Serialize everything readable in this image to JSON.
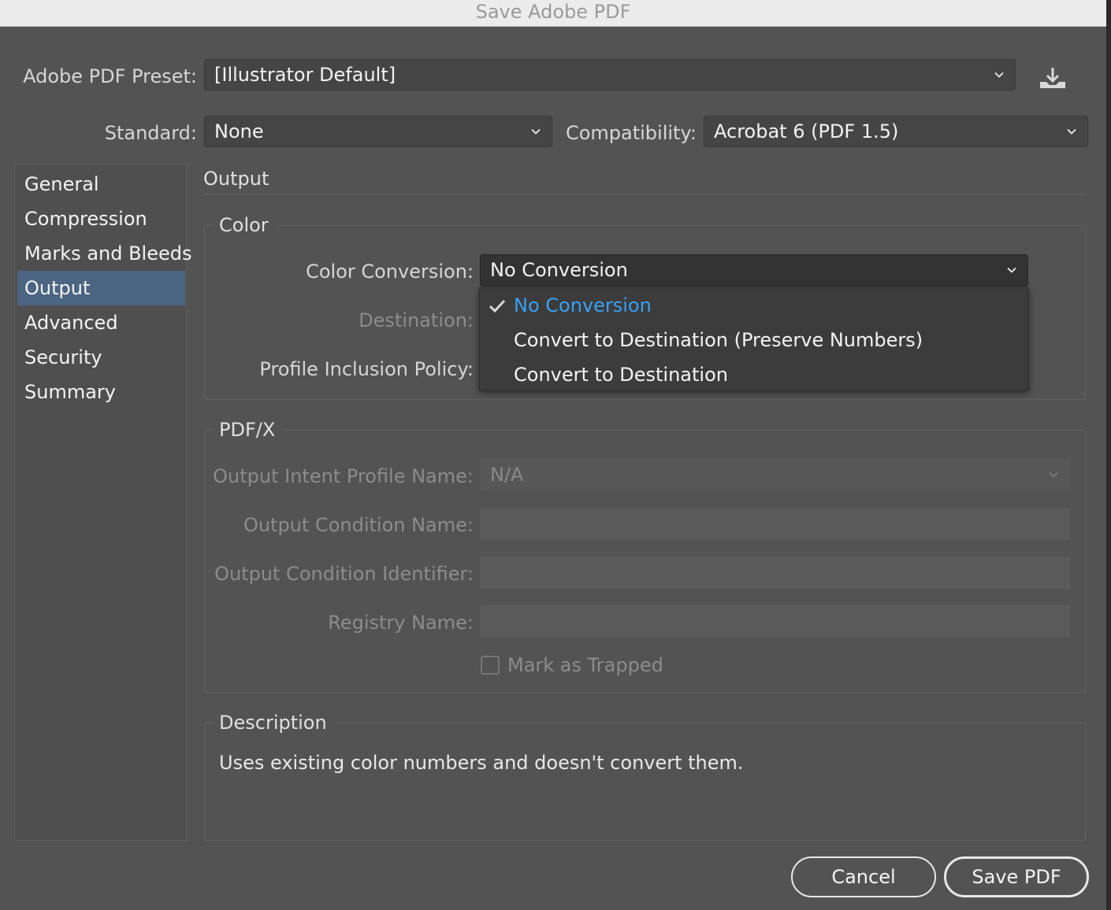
{
  "window": {
    "title": "Save Adobe PDF"
  },
  "preset": {
    "label": "Adobe PDF Preset:",
    "value": "[Illustrator Default]",
    "save_icon": "save-preset-icon"
  },
  "standard": {
    "label": "Standard:",
    "value": "None"
  },
  "compatibility": {
    "label": "Compatibility:",
    "value": "Acrobat 6 (PDF 1.5)"
  },
  "sidebar": {
    "items": [
      {
        "label": "General"
      },
      {
        "label": "Compression"
      },
      {
        "label": "Marks and Bleeds"
      },
      {
        "label": "Output"
      },
      {
        "label": "Advanced"
      },
      {
        "label": "Security"
      },
      {
        "label": "Summary"
      }
    ],
    "selected": "Output"
  },
  "panel": {
    "title": "Output"
  },
  "color": {
    "title": "Color",
    "conversion_label": "Color Conversion:",
    "conversion_value": "No Conversion",
    "destination_label": "Destination:",
    "profile_label": "Profile Inclusion Policy:",
    "menu": [
      {
        "label": "No Conversion",
        "checked": true
      },
      {
        "label": "Convert to Destination (Preserve Numbers)",
        "checked": false
      },
      {
        "label": "Convert to Destination",
        "checked": false
      }
    ]
  },
  "pdfx": {
    "title": "PDF/X",
    "intent_label": "Output Intent Profile Name:",
    "intent_value": "N/A",
    "condition_name_label": "Output Condition Name:",
    "condition_id_label": "Output Condition Identifier:",
    "registry_label": "Registry Name:",
    "trapped_label": "Mark as Trapped"
  },
  "description": {
    "title": "Description",
    "text": "Uses existing color numbers and doesn't convert them."
  },
  "buttons": {
    "cancel": "Cancel",
    "save": "Save PDF"
  },
  "colors": {
    "background": "#535353",
    "selection": "#4b6582",
    "checked_item": "#3aa0f5"
  }
}
